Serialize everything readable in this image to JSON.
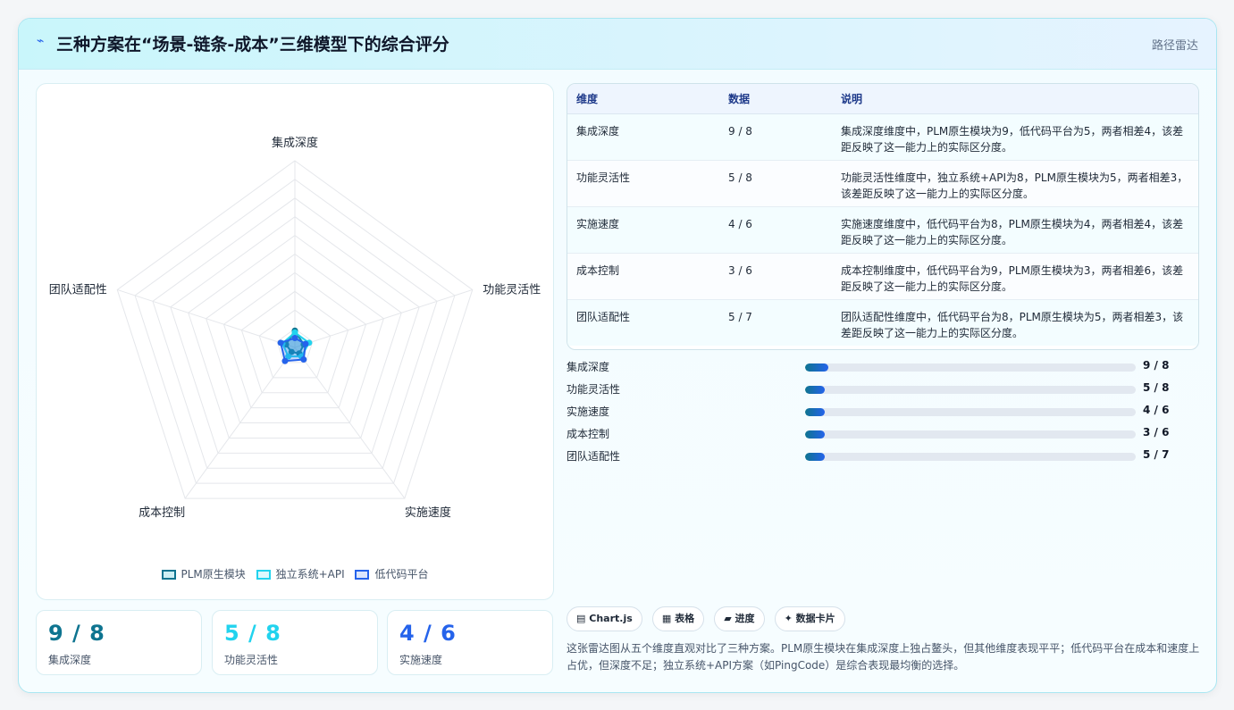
{
  "header": {
    "icon": "chart-icon",
    "title": "三种方案在“场景-链条-成本”三维模型下的综合评分",
    "right_label": "路径雷达"
  },
  "chart_data": {
    "type": "radar",
    "axes": [
      "集成深度",
      "功能灵活性",
      "实施速度",
      "成本控制",
      "团队适配性"
    ],
    "series": [
      {
        "name": "PLM原生模块",
        "values": [
          9,
          5,
          4,
          3,
          5
        ],
        "color": "#0e7490"
      },
      {
        "name": "独立系统+API",
        "values": [
          8,
          8,
          6,
          6,
          7
        ],
        "color": "#22d3ee"
      },
      {
        "name": "低代码平台",
        "values": [
          5,
          6,
          8,
          9,
          8
        ],
        "color": "#2563eb"
      }
    ],
    "rmax": 100,
    "grid_levels": 10
  },
  "stats": [
    {
      "value": "9 / 8",
      "label": "集成深度",
      "color": "#0e7490"
    },
    {
      "value": "5 / 8",
      "label": "功能灵活性",
      "color": "#22d3ee"
    },
    {
      "value": "4 / 6",
      "label": "实施速度",
      "color": "#2563eb"
    }
  ],
  "table": {
    "headers": [
      "维度",
      "数据",
      "说明"
    ],
    "rows": [
      {
        "dim": "集成深度",
        "data": "9 / 8",
        "desc": "集成深度维度中，PLM原生模块为9，低代码平台为5，两者相差4，该差距反映了这一能力上的实际区分度。"
      },
      {
        "dim": "功能灵活性",
        "data": "5 / 8",
        "desc": "功能灵活性维度中，独立系统+API为8，PLM原生模块为5，两者相差3，该差距反映了这一能力上的实际区分度。"
      },
      {
        "dim": "实施速度",
        "data": "4 / 6",
        "desc": "实施速度维度中，低代码平台为8，PLM原生模块为4，两者相差4，该差距反映了这一能力上的实际区分度。"
      },
      {
        "dim": "成本控制",
        "data": "3 / 6",
        "desc": "成本控制维度中，低代码平台为9，PLM原生模块为3，两者相差6，该差距反映了这一能力上的实际区分度。"
      },
      {
        "dim": "团队适配性",
        "data": "5 / 7",
        "desc": "团队适配性维度中，低代码平台为8，PLM原生模块为5，两者相差3，该差距反映了这一能力上的实际区分度。"
      }
    ]
  },
  "progress": [
    {
      "label": "集成深度",
      "value": "9 / 8",
      "fraction": 0.07
    },
    {
      "label": "功能灵活性",
      "value": "5 / 8",
      "fraction": 0.06
    },
    {
      "label": "实施速度",
      "value": "4 / 6",
      "fraction": 0.06
    },
    {
      "label": "成本控制",
      "value": "3 / 6",
      "fraction": 0.06
    },
    {
      "label": "团队适配性",
      "value": "5 / 7",
      "fraction": 0.06
    }
  ],
  "chips": [
    {
      "icon": "chart-icon",
      "glyph": "▤",
      "label": "Chart.js"
    },
    {
      "icon": "table-icon",
      "glyph": "▦",
      "label": "表格"
    },
    {
      "icon": "progress-icon",
      "glyph": "▰",
      "label": "进度"
    },
    {
      "icon": "data-card-icon",
      "glyph": "✦",
      "label": "数据卡片"
    }
  ],
  "description": "这张雷达图从五个维度直观对比了三种方案。PLM原生模块在集成深度上独占鳌头，但其他维度表现平平；低代码平台在成本和速度上占优，但深度不足；独立系统+API方案（如PingCode）是综合表现最均衡的选择。"
}
